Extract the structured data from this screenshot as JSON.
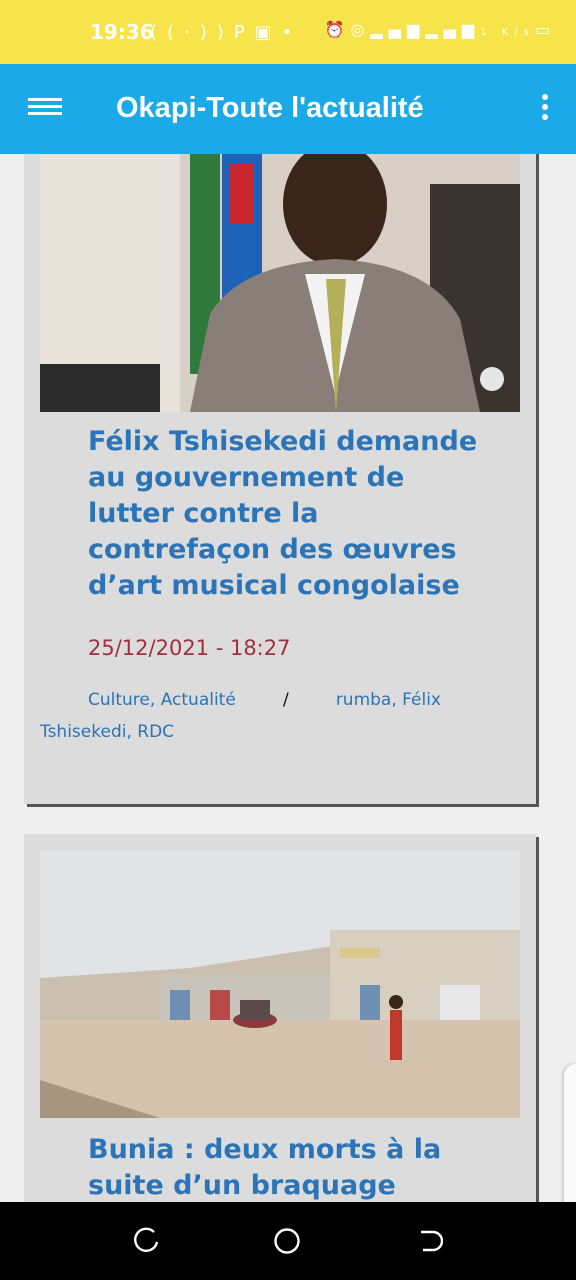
{
  "status_bar": {
    "time": "19:36",
    "left_icons": [
      "signal-wave-icon",
      "parking-icon",
      "app-icon",
      "dot-icon"
    ],
    "right_icons": [
      "alarm-icon",
      "hotspot-icon",
      "4g-signal-icon",
      "signal-icon",
      "data-speed-icon",
      "battery-icon"
    ],
    "data_speed": "1 K/s"
  },
  "app_bar": {
    "title": "Okapi-Toute l'actualité",
    "menu_icon": "hamburger-menu-icon",
    "overflow_icon": "more-vert-icon",
    "color": "#1ba9e8"
  },
  "articles": [
    {
      "headline": "Félix Tshisekedi demande au gouvernement de lutter contre la contrefaçon des œuvres d’art musical congolaise",
      "date": "25/12/2021 - 18:27",
      "categories": [
        "Culture",
        "Actualité"
      ],
      "separator": "/",
      "tags": [
        "rumba",
        "Félix Tshisekedi",
        "RDC"
      ]
    },
    {
      "headline": "Bunia : deux morts à la suite d’un braquage d’une"
    }
  ],
  "colors": {
    "headline": "#2b74b8",
    "date": "#a0313c",
    "card_bg": "#dcdcdc",
    "status_bar": "#f7e34a"
  }
}
